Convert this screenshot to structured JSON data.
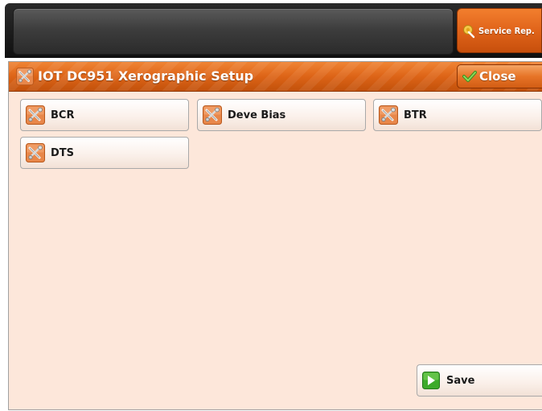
{
  "topbar": {
    "status_text": "",
    "service_rep": {
      "label": "Service Rep.",
      "icon": "service-rep-icon"
    }
  },
  "panel": {
    "title": "IOT DC951 Xerographic Setup",
    "title_icon": "tools-icon",
    "close_label": "Close",
    "close_icon": "checkmark-icon"
  },
  "buttons": [
    {
      "label": "BCR",
      "icon": "tools-icon"
    },
    {
      "label": "Deve Bias",
      "icon": "tools-icon"
    },
    {
      "label": "BTR",
      "icon": "tools-icon"
    },
    {
      "label": "DTS",
      "icon": "tools-icon"
    }
  ],
  "save": {
    "label": "Save",
    "icon": "play-icon"
  },
  "colors": {
    "accent_orange": "#e0641a",
    "panel_background": "#fde7da",
    "topbar_background": "#1a1a1a",
    "save_icon_green": "#3daa2a"
  }
}
